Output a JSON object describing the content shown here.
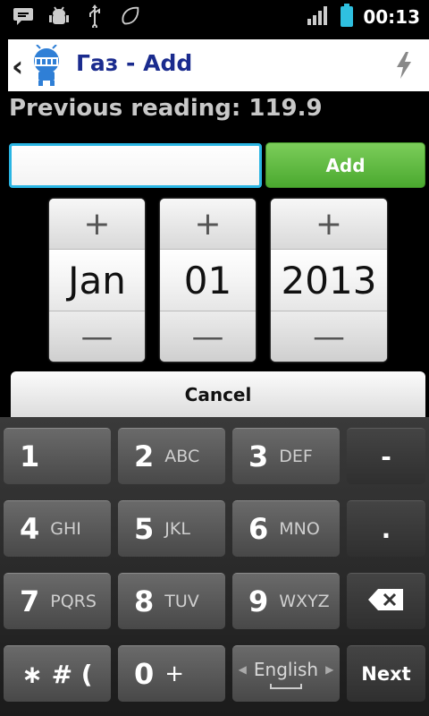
{
  "status": {
    "time": "00:13"
  },
  "titlebar": {
    "title": "Газ - Add"
  },
  "previous_reading": "Previous reading: 119.9",
  "form": {
    "input_value": "",
    "add_label": "Add",
    "cancel_label": "Cancel"
  },
  "picker": {
    "month": "Jan",
    "day": "01",
    "year": "2013",
    "plus": "+",
    "minus": "—"
  },
  "keyboard": {
    "keys": [
      {
        "num": "1",
        "letters": ""
      },
      {
        "num": "2",
        "letters": "ABC"
      },
      {
        "num": "3",
        "letters": "DEF"
      },
      {
        "num": "4",
        "letters": "GHI"
      },
      {
        "num": "5",
        "letters": "JKL"
      },
      {
        "num": "6",
        "letters": "MNO"
      },
      {
        "num": "7",
        "letters": "PQRS"
      },
      {
        "num": "8",
        "letters": "TUV"
      },
      {
        "num": "9",
        "letters": "WXYZ"
      },
      {
        "num": "0",
        "letters": "+"
      }
    ],
    "minus": "-",
    "dot": ".",
    "symbols": "∗ # (",
    "language": "English",
    "next": "Next"
  }
}
